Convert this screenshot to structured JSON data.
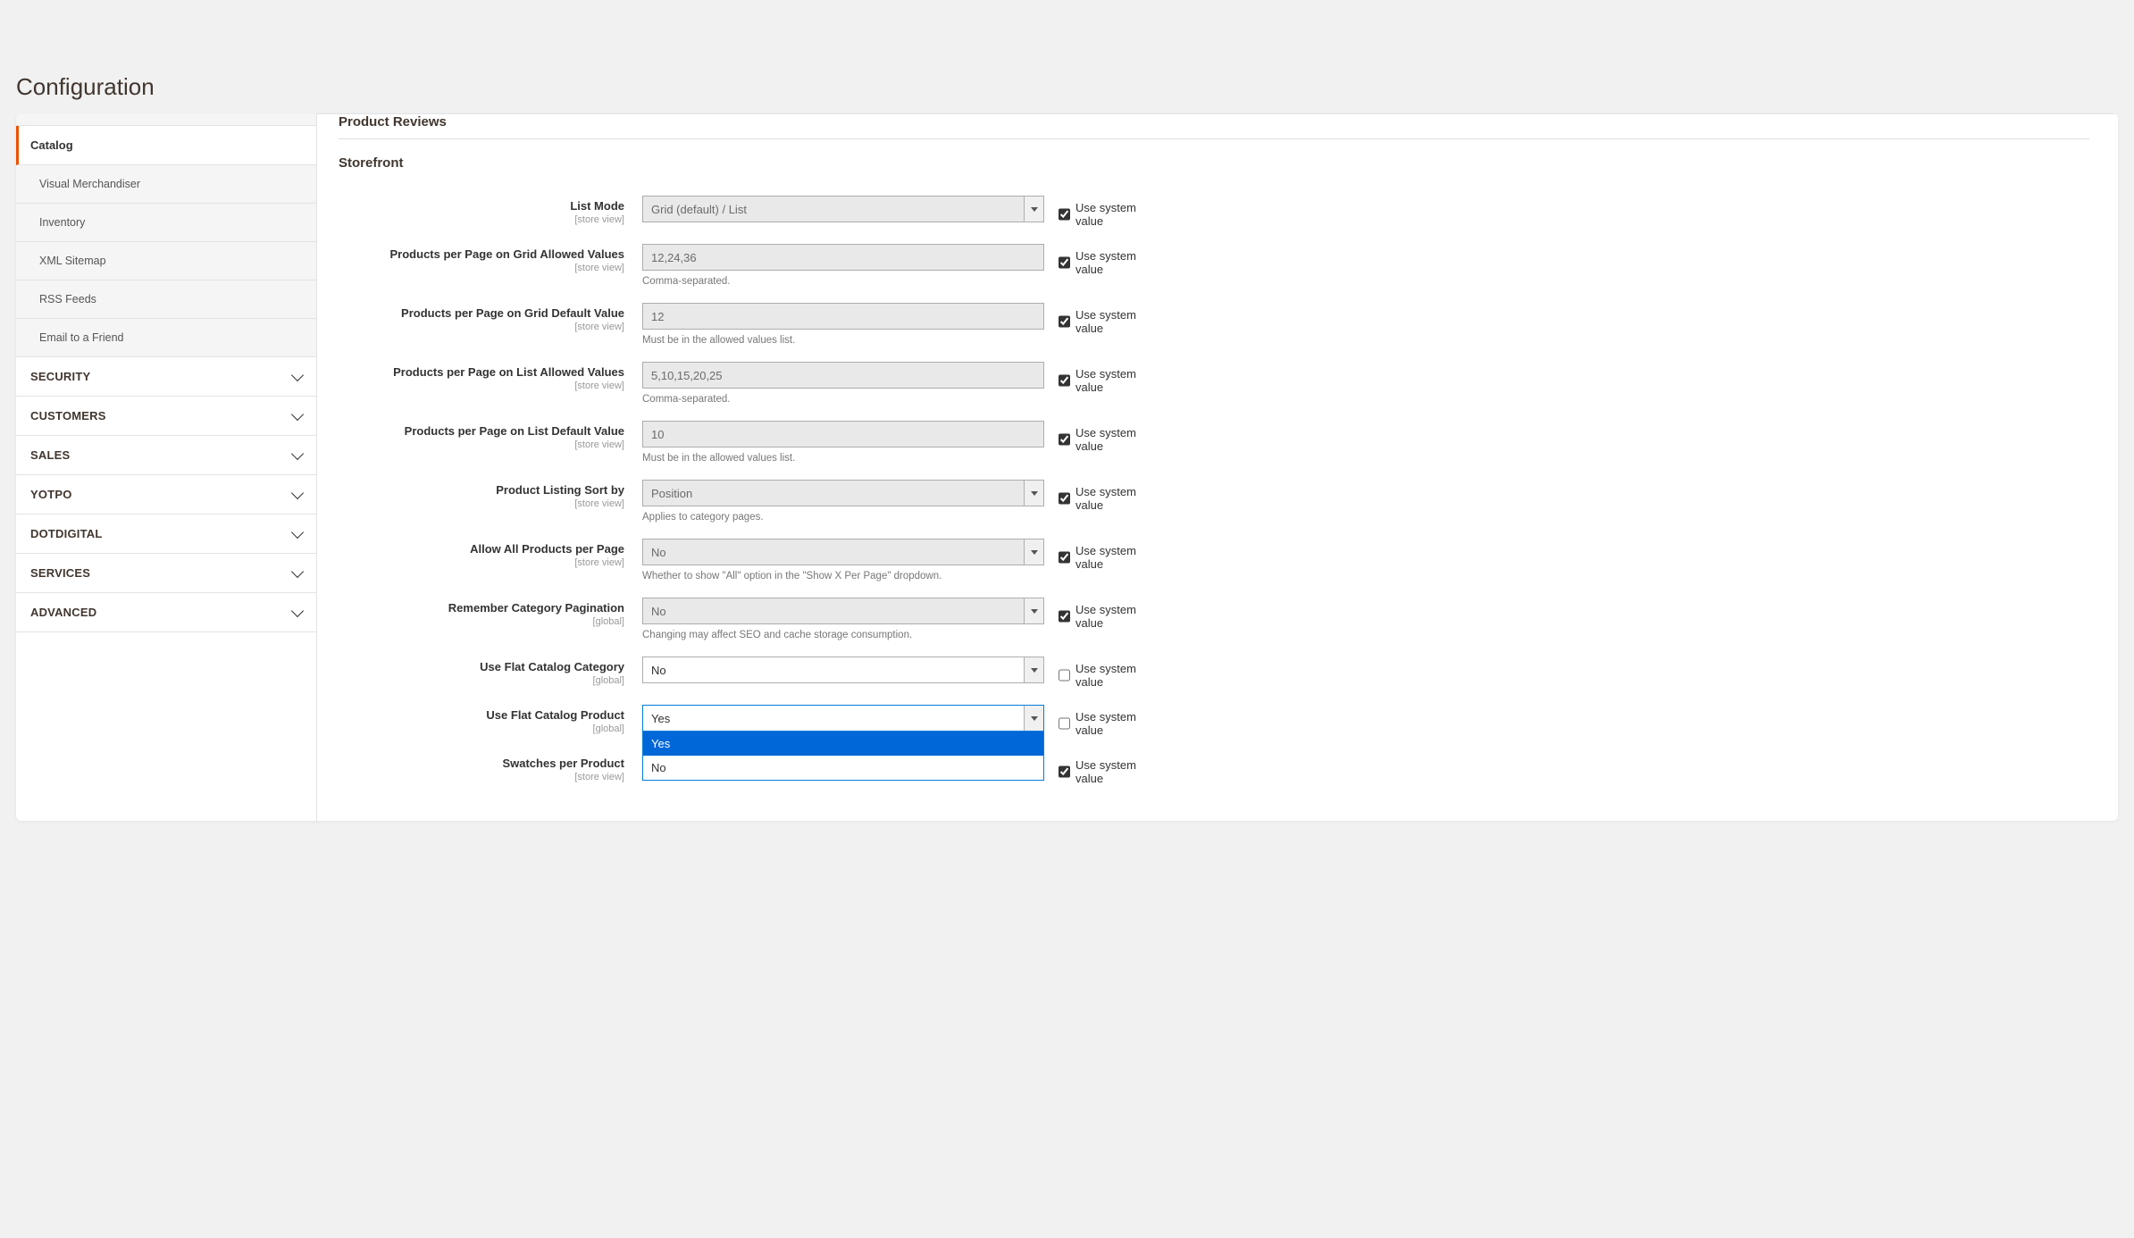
{
  "page": {
    "title": "Configuration"
  },
  "sidebar": {
    "items": [
      {
        "label": "Catalog",
        "active": true
      },
      {
        "label": "Visual Merchandiser"
      },
      {
        "label": "Inventory"
      },
      {
        "label": "XML Sitemap"
      },
      {
        "label": "RSS Feeds"
      },
      {
        "label": "Email to a Friend"
      }
    ],
    "sections": [
      {
        "label": "SECURITY"
      },
      {
        "label": "CUSTOMERS"
      },
      {
        "label": "SALES"
      },
      {
        "label": "YOTPO"
      },
      {
        "label": "DOTDIGITAL"
      },
      {
        "label": "SERVICES"
      },
      {
        "label": "ADVANCED"
      }
    ]
  },
  "main": {
    "product_reviews_header": "Product Reviews",
    "storefront_header": "Storefront",
    "use_system_value_label": "Use system value",
    "scope_store_view": "[store view]",
    "scope_global": "[global]",
    "fields": {
      "list_mode": {
        "label": "List Mode",
        "value": "Grid (default) / List"
      },
      "grid_allowed": {
        "label": "Products per Page on Grid Allowed Values",
        "value": "12,24,36",
        "help": "Comma-separated."
      },
      "grid_default": {
        "label": "Products per Page on Grid Default Value",
        "value": "12",
        "help": "Must be in the allowed values list."
      },
      "list_allowed": {
        "label": "Products per Page on List Allowed Values",
        "value": "5,10,15,20,25",
        "help": "Comma-separated."
      },
      "list_default": {
        "label": "Products per Page on List Default Value",
        "value": "10",
        "help": "Must be in the allowed values list."
      },
      "sort_by": {
        "label": "Product Listing Sort by",
        "value": "Position",
        "help": "Applies to category pages."
      },
      "allow_all": {
        "label": "Allow All Products per Page",
        "value": "No",
        "help": "Whether to show \"All\" option in the \"Show X Per Page\" dropdown."
      },
      "remember_pagination": {
        "label": "Remember Category Pagination",
        "value": "No",
        "help": "Changing may affect SEO and cache storage consumption."
      },
      "flat_category": {
        "label": "Use Flat Catalog Category",
        "value": "No"
      },
      "flat_product": {
        "label": "Use Flat Catalog Product",
        "value": "Yes",
        "options": [
          "Yes",
          "No"
        ]
      },
      "swatches": {
        "label": "Swatches per Product"
      }
    }
  }
}
